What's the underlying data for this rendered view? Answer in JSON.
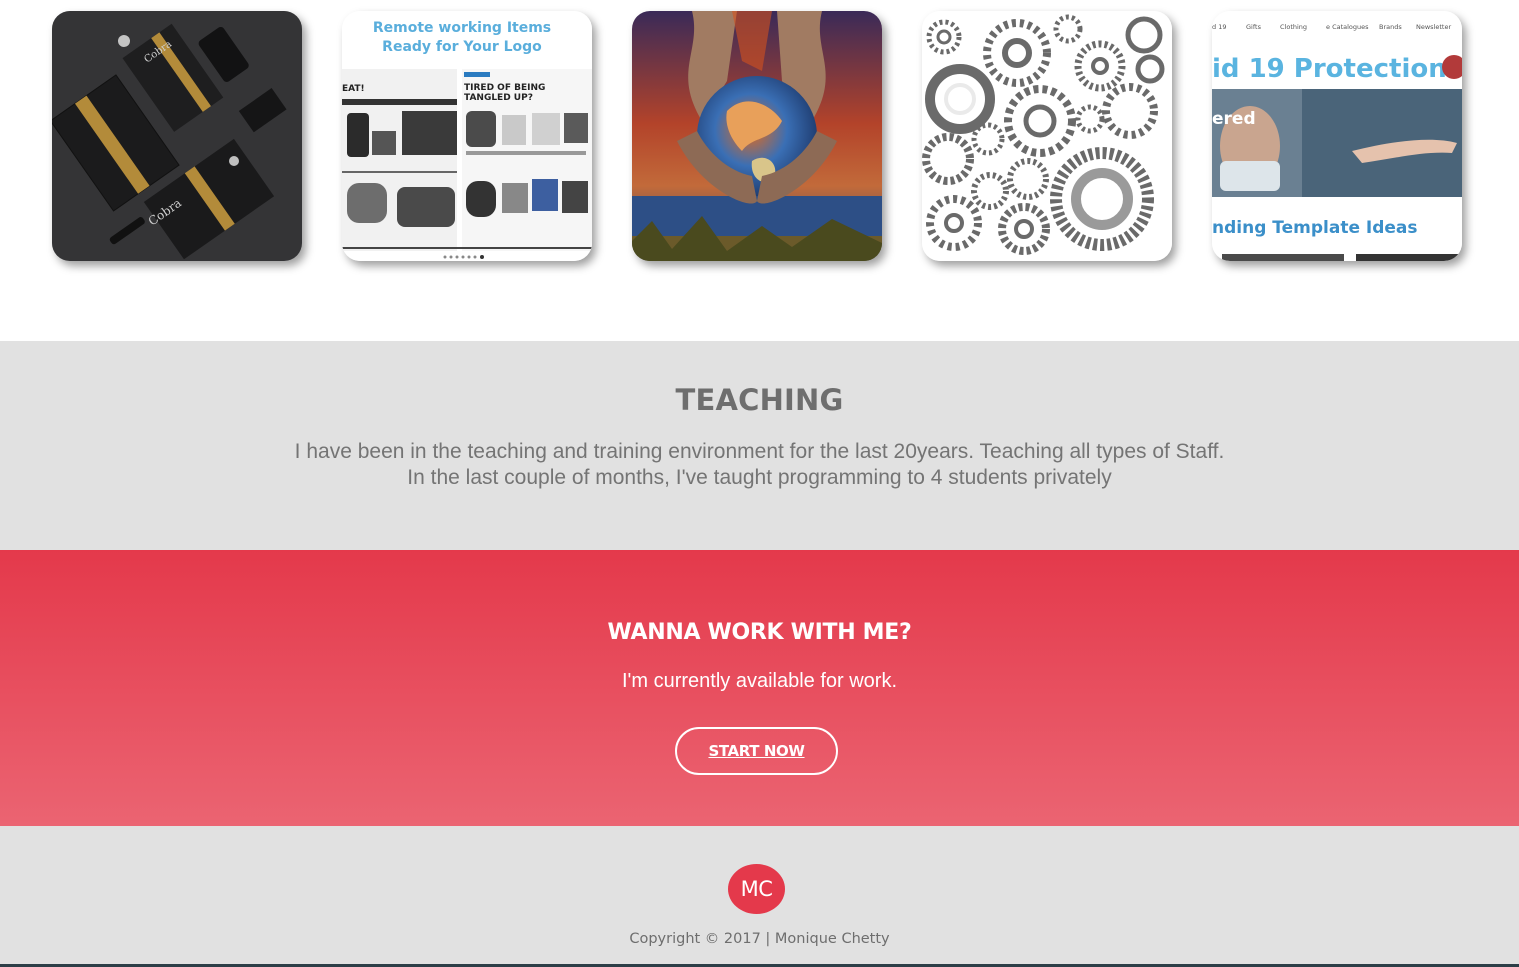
{
  "gallery": {
    "items": [
      {
        "name": "stationery-mockup",
        "texts": [
          "Cobra"
        ]
      },
      {
        "name": "remote-working-catalogue",
        "texts": [
          "Remote working Items",
          "Ready for Your Logo",
          "TIRED OF BEING",
          "TANGLED UP?",
          "EAT!"
        ]
      },
      {
        "name": "earth-in-hands"
      },
      {
        "name": "gears-illustration"
      },
      {
        "name": "covid-protection-site",
        "nav": [
          "d 19",
          "Gifts",
          "Clothing",
          "e Catalogues",
          "Brands",
          "Newsletter"
        ],
        "texts": [
          "id 19 Protection",
          "ered",
          "nding Template Ideas"
        ]
      }
    ]
  },
  "teaching": {
    "title": "TEACHING",
    "line1": "I have been in the teaching and training environment for the last 20years. Teaching all types of Staff.",
    "line2": "In the last couple of months, I've taught programming to 4 students privately"
  },
  "cta": {
    "title": "WANNA WORK WITH ME?",
    "subtitle": "I'm currently available for work.",
    "button": "START NOW"
  },
  "footer": {
    "logo": "MC",
    "copyright": "Copyright © 2017 | Monique Chetty"
  },
  "colors": {
    "accent": "#e4394b",
    "panel": "#e1e1e1",
    "text_grey": "#6e6e6e"
  }
}
